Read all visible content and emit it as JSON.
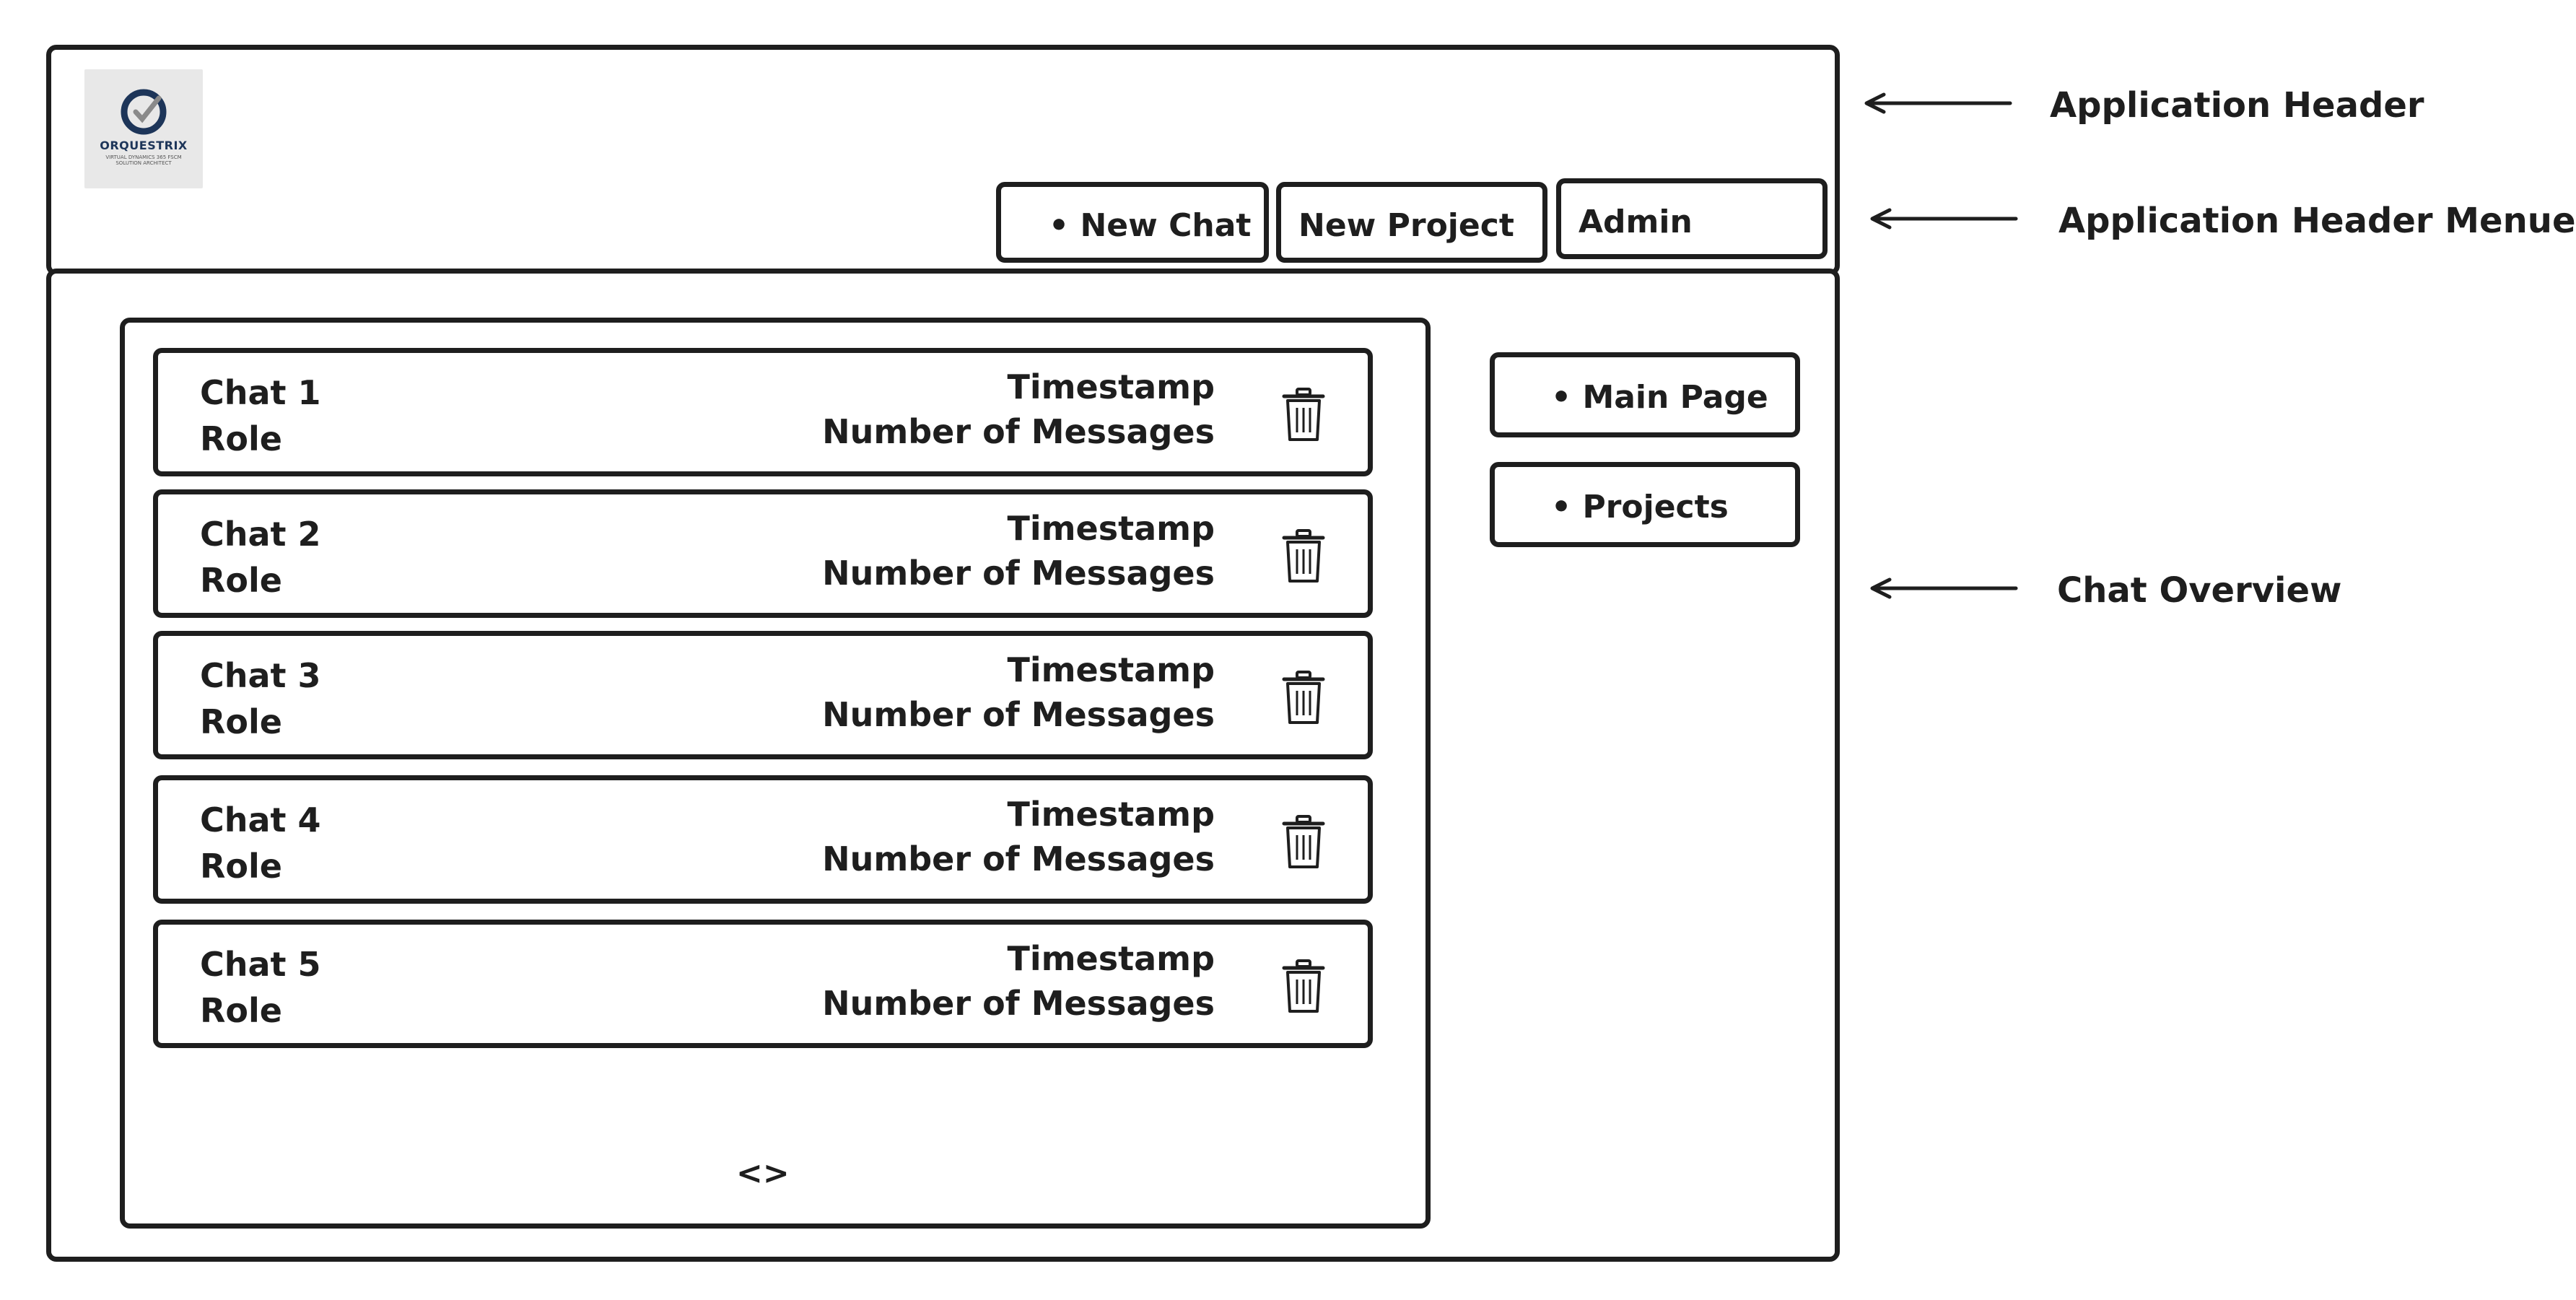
{
  "logo": {
    "brand": "ORQUESTRIX",
    "tagline": "VIRTUAL DYNAMICS 365 FSCM SOLUTION ARCHITECT",
    "colors": {
      "mark": "#1d3559",
      "check": "#8a8a8a",
      "background": "#e8e8e8"
    }
  },
  "header_menu": {
    "new_chat": "New Chat",
    "new_project": "New Project",
    "admin": "Admin"
  },
  "chats": [
    {
      "name": "Chat 1",
      "role": "Role",
      "timestamp": "Timestamp",
      "messages": "Number of Messages",
      "icon": "trash-icon"
    },
    {
      "name": "Chat 2",
      "role": "Role",
      "timestamp": "Timestamp",
      "messages": "Number of Messages",
      "icon": "trash-icon"
    },
    {
      "name": "Chat 3",
      "role": "Role",
      "timestamp": "Timestamp",
      "messages": "Number of Messages",
      "icon": "trash-icon"
    },
    {
      "name": "Chat 4",
      "role": "Role",
      "timestamp": "Timestamp",
      "messages": "Number of Messages",
      "icon": "trash-icon"
    },
    {
      "name": "Chat 5",
      "role": "Role",
      "timestamp": "Timestamp",
      "messages": "Number of Messages",
      "icon": "trash-icon"
    }
  ],
  "pager": "<>",
  "side_nav": {
    "main_page": "Main Page",
    "projects": "Projects"
  },
  "annotations": {
    "header": "Application Header",
    "header_menu": "Application Header Menue",
    "chat_overview": "Chat Overview"
  }
}
